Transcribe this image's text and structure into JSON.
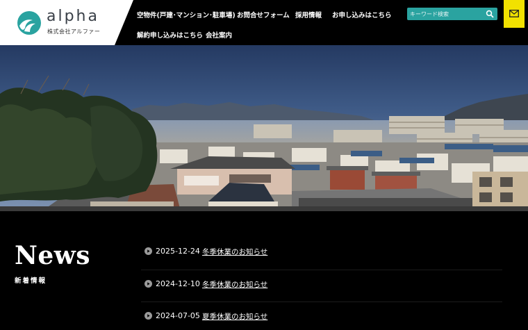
{
  "header": {
    "logo_text": "alpha",
    "logo_sub": "株式会社アルファー",
    "nav": [
      {
        "label": "空物件(戸建･マンション･駐車場)"
      },
      {
        "label": "お問合せフォーム"
      },
      {
        "label": "採用情報"
      },
      {
        "label": "お申し込みはこちら"
      },
      {
        "label": "解約申し込みはこちら"
      },
      {
        "label": "会社案内"
      }
    ],
    "search": {
      "placeholder": "キーワード検索"
    }
  },
  "news": {
    "title": "News",
    "subtitle": "新着情報",
    "items": [
      {
        "date": "2025-12-24",
        "title": "冬季休業のお知らせ"
      },
      {
        "date": "2024-12-10",
        "title": "冬季休業のお知らせ"
      },
      {
        "date": "2024-07-05",
        "title": "夏季休業のお知らせ"
      }
    ]
  },
  "colors": {
    "brand_teal": "#2aa3a0",
    "mail_yellow": "#f2e100",
    "background": "#000000"
  },
  "icons": {
    "logo": "wave-circle-logo-icon",
    "search": "search-icon",
    "mail": "mail-icon",
    "bullet": "play-circle-icon"
  }
}
